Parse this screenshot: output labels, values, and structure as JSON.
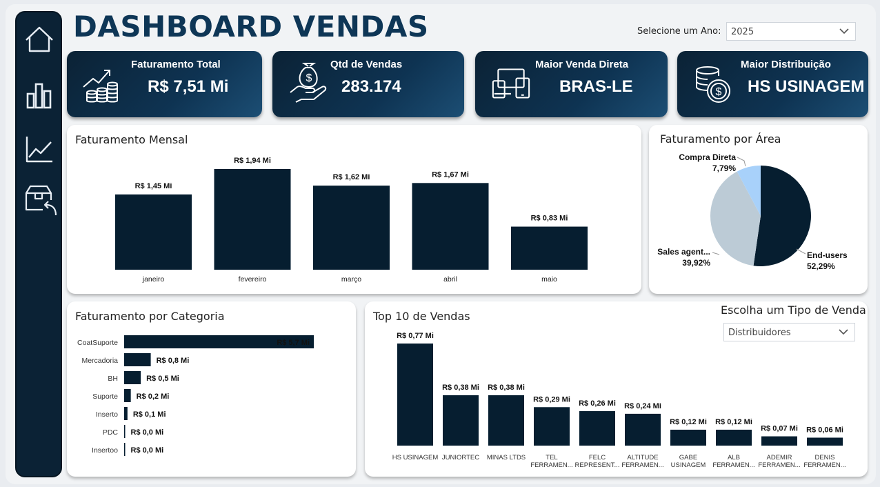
{
  "header": {
    "title": "DASHBOARD VENDAS",
    "year_label": "Selecione um Ano:",
    "year_value": "2025"
  },
  "nav": [
    "home-icon",
    "bar-chart-icon",
    "line-chart-icon",
    "box-return-icon"
  ],
  "kpis": [
    {
      "label": "Faturamento Total",
      "value": "R$ 7,51 Mi",
      "icon": "money-growth-icon"
    },
    {
      "label": "Qtd de Vendas",
      "value": "283.174",
      "icon": "money-bag-hand-icon"
    },
    {
      "label": "Maior Venda Direta",
      "value": "BRAS-LE",
      "icon": "devices-icon"
    },
    {
      "label": "Maior Distribuição",
      "value": "HS USINAGEM",
      "icon": "coins-icon"
    }
  ],
  "colors": {
    "bar": "#061e30",
    "accent": "#0e3656",
    "pie_mid": "#bccbd6",
    "pie_light": "#a8d1fa"
  },
  "monthly": {
    "title": "Faturamento Mensal",
    "chart_data": {
      "type": "bar",
      "categories": [
        "janeiro",
        "fevereiro",
        "março",
        "abril",
        "maio"
      ],
      "values": [
        1.45,
        1.94,
        1.62,
        1.67,
        0.83
      ],
      "labels": [
        "R$ 1,45 Mi",
        "R$ 1,94 Mi",
        "R$ 1,62 Mi",
        "R$ 1,67 Mi",
        "R$ 0,83 Mi"
      ]
    }
  },
  "area": {
    "title": "Faturamento por Área",
    "chart_data": {
      "type": "pie",
      "slices": [
        {
          "name": "End-users",
          "value": 52.29,
          "label": "52,29%"
        },
        {
          "name": "Sales agent...",
          "value": 39.92,
          "label": "39,92%"
        },
        {
          "name": "Compra Direta",
          "value": 7.79,
          "label": "7,79%"
        }
      ]
    }
  },
  "category": {
    "title": "Faturamento por Categoria",
    "chart_data": {
      "type": "bar",
      "orientation": "horizontal",
      "categories": [
        "CoatSuporte",
        "Mercadoria",
        "BH",
        "Suporte",
        "Inserto",
        "PDC",
        "Insertoo"
      ],
      "values": [
        5.7,
        0.8,
        0.5,
        0.2,
        0.1,
        0.0,
        0.0
      ],
      "labels": [
        "R$ 5,7 Mi",
        "R$ 0,8 Mi",
        "R$ 0,5 Mi",
        "R$ 0,2 Mi",
        "R$ 0,1 Mi",
        "R$ 0,0 Mi",
        "R$ 0,0 Mi"
      ]
    }
  },
  "top10": {
    "title": "Top 10 de Vendas",
    "filter_label": "Escolha um Tipo de Venda",
    "filter_value": "Distribuidores",
    "chart_data": {
      "type": "bar",
      "categories": [
        [
          "HS USINAGEM"
        ],
        [
          "JUNIORTEC"
        ],
        [
          "MINAS LTDS"
        ],
        [
          "TEL",
          "FERRAMEN..."
        ],
        [
          "FELC",
          "REPRESENT..."
        ],
        [
          "ALTITUDE",
          "FERRAMEN..."
        ],
        [
          "GABE",
          "USINAGEM"
        ],
        [
          "ALB",
          "FERRAMEN..."
        ],
        [
          "ADEMIR",
          "FERRAMEN..."
        ],
        [
          "DENIS",
          "FERRAMEN..."
        ]
      ],
      "values": [
        0.77,
        0.38,
        0.38,
        0.29,
        0.26,
        0.24,
        0.12,
        0.12,
        0.07,
        0.06
      ],
      "labels": [
        "R$ 0,77 Mi",
        "R$ 0,38 Mi",
        "R$ 0,38 Mi",
        "R$ 0,29 Mi",
        "R$ 0,26 Mi",
        "R$ 0,24 Mi",
        "R$ 0,12 Mi",
        "R$ 0,12 Mi",
        "R$ 0,07 Mi",
        "R$ 0,06 Mi"
      ]
    }
  }
}
